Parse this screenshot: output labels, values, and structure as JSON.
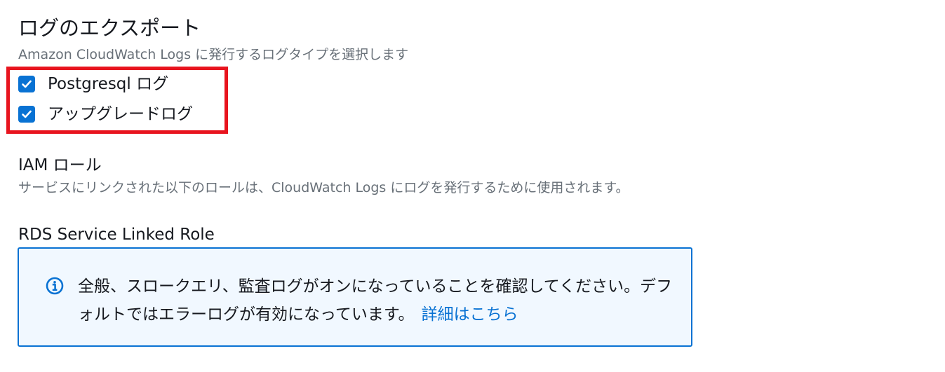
{
  "log_export": {
    "title": "ログのエクスポート",
    "description": "Amazon CloudWatch Logs に発行するログタイプを選択します",
    "options": [
      {
        "label": "Postgresql ログ",
        "checked": true
      },
      {
        "label": "アップグレードログ",
        "checked": true
      }
    ]
  },
  "iam_role": {
    "label": "IAM ロール",
    "description": "サービスにリンクされた以下のロールは、CloudWatch Logs にログを発行するために使用されます。",
    "value": "RDS Service Linked Role"
  },
  "info_alert": {
    "icon": "info-icon",
    "text": "全般、スロークエリ、監査ログがオンになっていることを確認してください。デフォルトではエラーログが有効になっています。",
    "link_label": "詳細はこちら"
  },
  "colors": {
    "accent": "#0972d3",
    "highlight": "#e8141e",
    "alert_background": "#f1f8ff",
    "secondary_text": "#687078"
  }
}
